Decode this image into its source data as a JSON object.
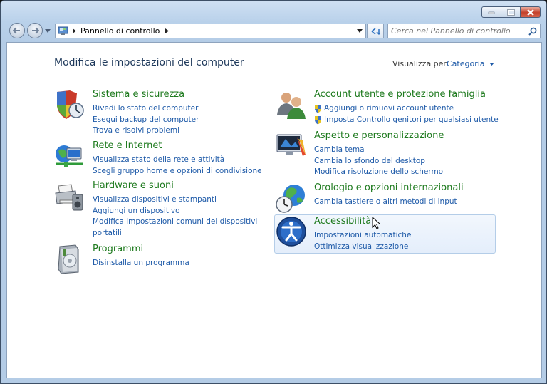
{
  "toolbar": {
    "breadcrumb": "Pannello di controllo",
    "search_placeholder": "Cerca nel Pannello di controllo"
  },
  "main": {
    "title": "Modifica le impostazioni del computer",
    "view_by_label": "Visualizza per:",
    "view_by_value": "Categoria"
  },
  "categories": [
    {
      "name": "Sistema e sicurezza",
      "icon": "shield-clock-icon",
      "links": [
        "Rivedi lo stato del computer",
        "Esegui backup del computer",
        "Trova e risolvi problemi"
      ]
    },
    {
      "name": "Rete e Internet",
      "icon": "network-globe-icon",
      "links": [
        "Visualizza stato della rete e attività",
        "Scegli gruppo home e opzioni di condivisione"
      ]
    },
    {
      "name": "Hardware e suoni",
      "icon": "printer-speaker-icon",
      "links": [
        "Visualizza dispositivi e stampanti",
        "Aggiungi un dispositivo",
        "Modifica impostazioni comuni dei dispositivi",
        "portatili"
      ]
    },
    {
      "name": "Programmi",
      "icon": "programs-box-icon",
      "links": [
        "Disinstalla un programma"
      ]
    },
    {
      "name": "Account utente e protezione famiglia",
      "icon": "users-icon",
      "links": [
        "Aggiungi o rimuovi account utente",
        "Imposta Controllo genitori per qualsiasi utente"
      ]
    },
    {
      "name": "Aspetto e personalizzazione",
      "icon": "display-paint-icon",
      "links": [
        "Cambia tema",
        "Cambia lo sfondo del desktop",
        "Modifica risoluzione dello schermo"
      ]
    },
    {
      "name": "Orologio e opzioni internazionali",
      "icon": "globe-clock-icon",
      "links": [
        "Cambia tastiere o altri metodi di input"
      ]
    },
    {
      "name": "Accessibilità",
      "icon": "accessibility-icon",
      "links": [
        "Impostazioni automatiche",
        "Ottimizza visualizzazione"
      ]
    }
  ]
}
